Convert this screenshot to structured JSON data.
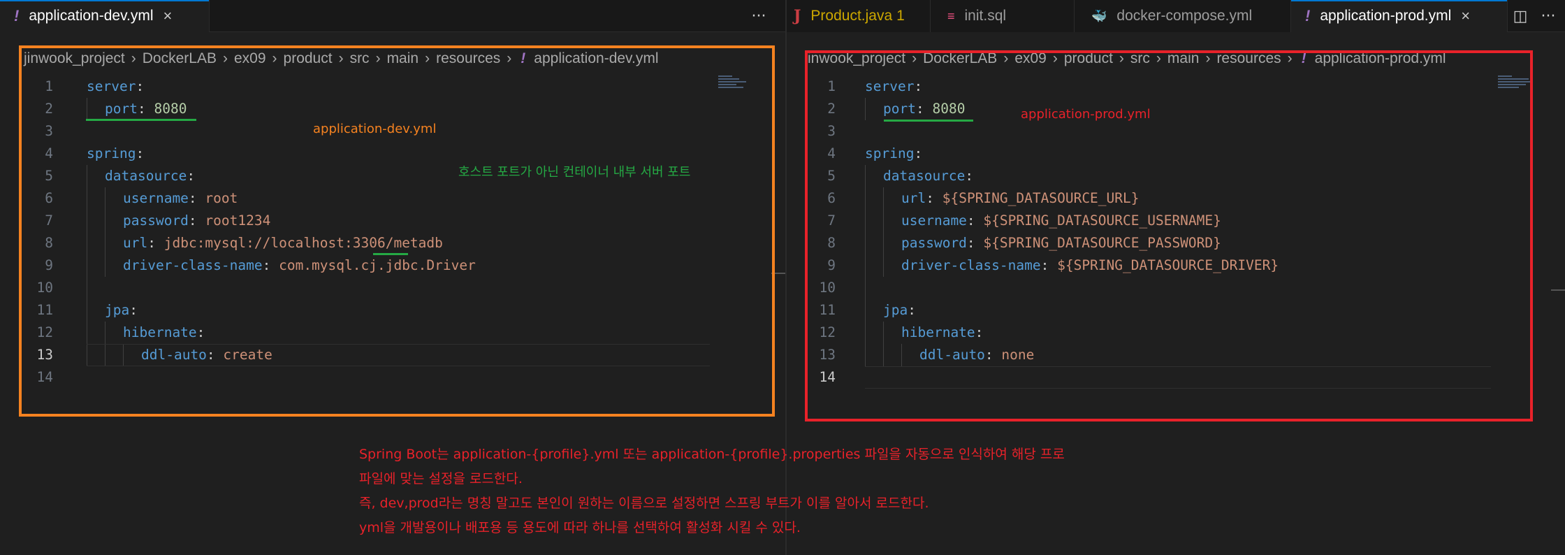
{
  "left_editor": {
    "tab": {
      "icon": "!",
      "label": "application-dev.yml",
      "close": "×"
    },
    "more_actions": "···",
    "breadcrumb": [
      "jinwook_project",
      "DockerLAB",
      "ex09",
      "product",
      "src",
      "main",
      "resources"
    ],
    "breadcrumb_file_icon": "!",
    "breadcrumb_file": "application-dev.yml",
    "line_numbers": [
      "1",
      "2",
      "3",
      "4",
      "5",
      "6",
      "7",
      "8",
      "9",
      "10",
      "11",
      "12",
      "13",
      "14"
    ],
    "lines": {
      "l1_key": "server",
      "colon": ":",
      "l2_key": "port",
      "l2_val": "8080",
      "l4_key": "spring",
      "l5_key": "datasource",
      "l6_key": "username",
      "l6_val": "root",
      "l7_key": "password",
      "l7_val": "root1234",
      "l8_key": "url",
      "l8_val": "jdbc:mysql://localhost:3306/metadb",
      "l9_key": "driver-class-name",
      "l9_val": "com.mysql.cj.jdbc.Driver",
      "l11_key": "jpa",
      "l12_key": "hibernate",
      "l13_key": "ddl-auto",
      "l13_val": "create"
    },
    "current_line": 13
  },
  "right_editor": {
    "tabs": [
      {
        "icon": "J",
        "label": "Product.java",
        "badge": "1"
      },
      {
        "icon": "≡",
        "label": "init.sql"
      },
      {
        "icon": "🐳",
        "label": "docker-compose.yml"
      },
      {
        "icon": "!",
        "label": "application-prod.yml",
        "close": "×"
      }
    ],
    "split_icon": "◫",
    "more_actions": "···",
    "breadcrumb": [
      "inwook_project",
      "DockerLAB",
      "ex09",
      "product",
      "src",
      "main",
      "resources"
    ],
    "breadcrumb_file_icon": "!",
    "breadcrumb_file": "application-prod.yml",
    "line_numbers": [
      "1",
      "2",
      "3",
      "4",
      "5",
      "6",
      "7",
      "8",
      "9",
      "10",
      "11",
      "12",
      "13",
      "14"
    ],
    "lines": {
      "l1_key": "server",
      "colon": ":",
      "l2_key": "port",
      "l2_val": "8080",
      "l4_key": "spring",
      "l5_key": "datasource",
      "l6_key": "url",
      "l6_val": "${SPRING_DATASOURCE_URL}",
      "l7_key": "username",
      "l7_val": "${SPRING_DATASOURCE_USERNAME}",
      "l8_key": "password",
      "l8_val": "${SPRING_DATASOURCE_PASSWORD}",
      "l9_key": "driver-class-name",
      "l9_val": "${SPRING_DATASOURCE_DRIVER}",
      "l11_key": "jpa",
      "l12_key": "hibernate",
      "l13_key": "ddl-auto",
      "l13_val": "none"
    },
    "current_line": 14
  },
  "annotations": {
    "dev_label": "application-dev.yml",
    "prod_label": "application-prod.yml",
    "port_note": "호스트 포트가 아닌 컨테이너 내부 서버 포트",
    "notes": [
      "Spring Boot는 application-{profile}.yml 또는 application-{profile}.properties 파일을 자동으로 인식하여 해당 프로",
      "파일에 맞는 설정을 로드한다.",
      " 즉, dev,prod라는 명칭 말고도 본인이 원하는 이름으로 설정하면 스프링 부트가 이를 알아서 로드한다.",
      "yml을 개발용이나 배포용 등 용도에 따라 하나를 선택하여 활성화 시킬 수 있다."
    ]
  },
  "colors": {
    "annotation_orange": "#f58220",
    "annotation_red": "#e8222a",
    "annotation_green": "#25a944",
    "yaml_key": "#569cd6",
    "yaml_string": "#ce9178",
    "yaml_number": "#b5cea8"
  }
}
